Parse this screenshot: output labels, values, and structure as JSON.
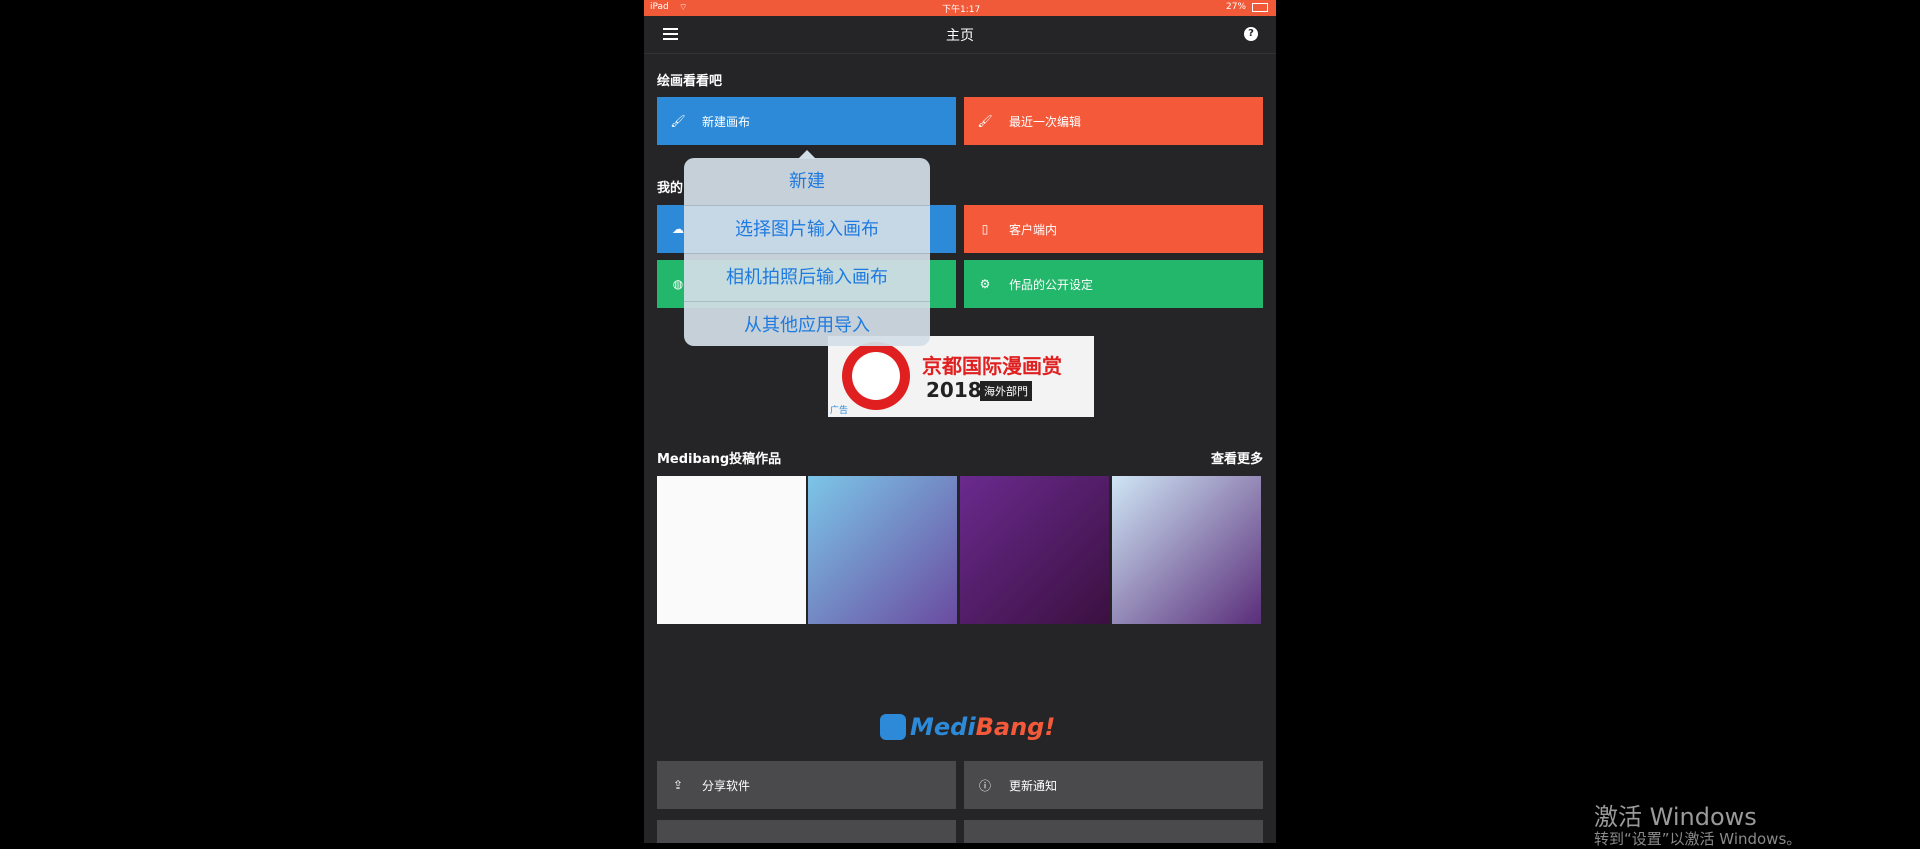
{
  "status_bar": {
    "device": "iPad",
    "time": "下午1:17",
    "battery": "27%"
  },
  "nav": {
    "title": "主页",
    "help": "?"
  },
  "draw_section": {
    "title": "绘画看看吧",
    "new_canvas": "新建画布",
    "recent_edit": "最近一次编辑"
  },
  "my_section": {
    "title": "我的",
    "client": "客户端内",
    "public_settings": "作品的公开设定"
  },
  "popover": {
    "options": [
      "新建",
      "选择图片输入画布",
      "相机拍照后输入画布",
      "从其他应用导入"
    ]
  },
  "ad": {
    "title": "京都国际漫画赏",
    "year": "2018",
    "badge": "海外部門",
    "tag": "广告"
  },
  "gallery": {
    "title": "Medibang投稿作品",
    "see_more": "查看更多"
  },
  "logo": {
    "medi": "Medi",
    "bang": "Bang!"
  },
  "bottom": {
    "share": "分享软件",
    "update": "更新通知"
  },
  "watermark": {
    "line1": "激活 Windows",
    "line2": "转到“设置”以激活 Windows。"
  },
  "colors": {
    "blue": "#2d8ad8",
    "orange": "#f45a3a",
    "green": "#22b76b",
    "gray": "#4a4a4c",
    "status": "#f05a38"
  }
}
